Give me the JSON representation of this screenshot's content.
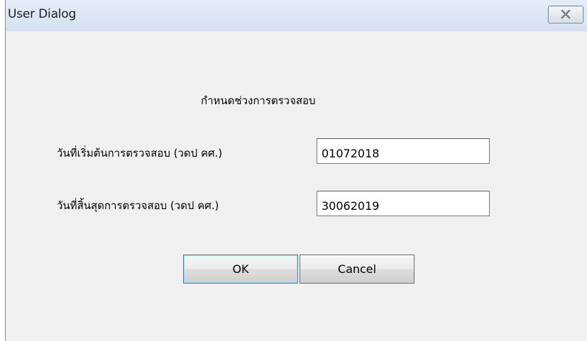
{
  "window": {
    "title": "User Dialog"
  },
  "dialog": {
    "heading": "กำหนดช่วงการตรวจสอบ",
    "start_date": {
      "label": "วันที่เริ่มต้นการตรวจสอบ (วดป คศ.)",
      "value": "01072018"
    },
    "end_date": {
      "label": "วันที่สิ้นสุดการตรวจสอบ (วดป คศ.)",
      "value": "30062019"
    },
    "buttons": {
      "ok_label": "OK",
      "cancel_label": "Cancel"
    }
  },
  "icons": {
    "close": "close-icon"
  },
  "colors": {
    "titlebar": "#dbe6f4",
    "dialog_background": "#f0f0f0",
    "default_button_border": "#3c7fb1"
  }
}
